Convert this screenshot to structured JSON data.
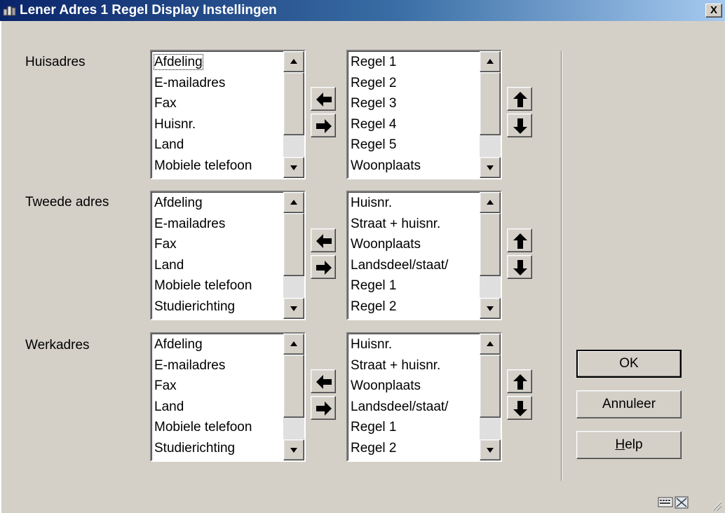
{
  "window": {
    "title": "Lener Adres 1 Regel Display Instellingen",
    "close_label": "X"
  },
  "sections": [
    {
      "label": "Huisadres",
      "available": [
        "Afdeling",
        "E-mailadres",
        "Fax",
        "Huisnr.",
        "Land",
        "Mobiele telefoon"
      ],
      "selected": [
        "Regel 1",
        "Regel 2",
        "Regel 3",
        "Regel 4",
        "Regel 5",
        "Woonplaats"
      ]
    },
    {
      "label": "Tweede adres",
      "available": [
        "Afdeling",
        "E-mailadres",
        "Fax",
        "Land",
        "Mobiele telefoon",
        "Studierichting"
      ],
      "selected": [
        "Huisnr.",
        "Straat + huisnr.",
        "Woonplaats",
        "Landsdeel/staat/",
        "Regel 1",
        "Regel 2"
      ]
    },
    {
      "label": "Werkadres",
      "available": [
        "Afdeling",
        "E-mailadres",
        "Fax",
        "Land",
        "Mobiele telefoon",
        "Studierichting"
      ],
      "selected": [
        "Huisnr.",
        "Straat + huisnr.",
        "Woonplaats",
        "Landsdeel/staat/",
        "Regel 1",
        "Regel 2"
      ]
    }
  ],
  "buttons": {
    "ok": "OK",
    "cancel": "Annuleer",
    "help_mnemonic": "H",
    "help_rest": "elp"
  },
  "icons": {
    "app": "app-icon",
    "move_left": "arrow-left-icon",
    "move_right": "arrow-right-icon",
    "move_up": "arrow-up-icon",
    "move_down": "arrow-down-icon",
    "status_1": "keyboard-icon",
    "status_2": "maximize-icon"
  }
}
